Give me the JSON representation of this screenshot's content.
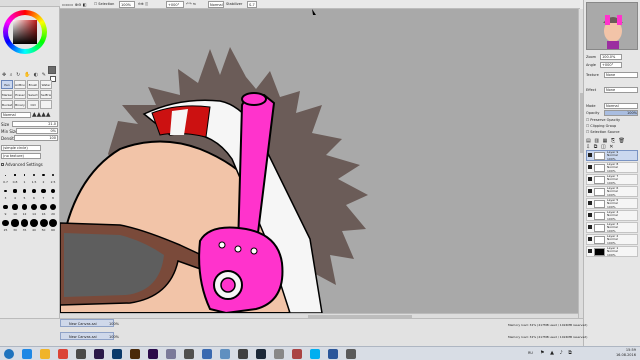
{
  "toolbar": {
    "selection_label": "Selection",
    "zoom_value": "100%",
    "rotation_value": "+000°",
    "blend_value": "Normal",
    "stabilizer_label": "Stabilizer",
    "stabilizer_value": "S-7"
  },
  "tools": {
    "row1": [
      "Pen",
      "AirBrush",
      "Brush",
      "Water"
    ],
    "row2": [
      "Marker",
      "Eraser",
      "Select",
      "SelEraser"
    ],
    "row3": [
      "Bucket",
      "Binary",
      "Old Pen",
      ""
    ],
    "blend_mode": "Normal",
    "size_label": "Size",
    "size_value": "21.0",
    "min_size_label": "Min Size",
    "min_size_value": "0%",
    "density_label": "Density",
    "density_value": "100",
    "shape_value": "(simple circle)",
    "texture_value": "(no texture)",
    "advanced_label": "Advanced Settings",
    "preset_sizes": [
      "0.7",
      "0.8",
      "1",
      "1.5",
      "2",
      "2.5",
      "3",
      "4",
      "5",
      "6",
      "7",
      "8",
      "9",
      "10",
      "12",
      "14",
      "16",
      "20",
      "25",
      "30",
      "35",
      "40",
      "50",
      "60"
    ]
  },
  "navigator": {
    "zoom_label": "Zoom",
    "zoom_value": "100.0%",
    "angle_label": "Angle",
    "angle_value": "+000°"
  },
  "layer_props": {
    "texture_label": "Texture",
    "texture_value": "None",
    "effect_label": "Effect",
    "effect_value": "None",
    "mode_label": "Mode",
    "mode_value": "Normal",
    "opacity_label": "Opacity",
    "opacity_value": "100%",
    "preserve_opacity": "Preserve Opacity",
    "clipping_group": "Clipping Group",
    "selection_source": "Selection Source"
  },
  "layers": [
    {
      "name": "Layer 9",
      "mode": "Normal",
      "opacity": "100%",
      "selected": true
    },
    {
      "name": "Layer 8",
      "mode": "Normal",
      "opacity": "100%",
      "selected": false
    },
    {
      "name": "Layer 7",
      "mode": "Normal",
      "opacity": "100%",
      "selected": false
    },
    {
      "name": "Layer 6",
      "mode": "Normal",
      "opacity": "100%",
      "selected": false
    },
    {
      "name": "Layer 5",
      "mode": "Normal",
      "opacity": "100%",
      "selected": false
    },
    {
      "name": "Layer 4",
      "mode": "Normal",
      "opacity": "100%",
      "selected": false
    },
    {
      "name": "Layer 3",
      "mode": "Normal",
      "opacity": "100%",
      "selected": false
    },
    {
      "name": "Layer 2",
      "mode": "Normal",
      "opacity": "100%",
      "selected": false
    },
    {
      "name": "Layer 1",
      "mode": "Normal",
      "opacity": "100%",
      "selected": false
    }
  ],
  "documents": [
    {
      "name": "New Canvas.sai",
      "zoom": "100%"
    },
    {
      "name": "New Canvas.sai",
      "zoom": "100%"
    }
  ],
  "status": {
    "memory_1": "Memory load: 32% (417MB used / 1024MB reserved)",
    "memory_2": "Memory load: 32% (417MB used / 1024MB reserved)"
  },
  "taskbar": {
    "apps": [
      "start",
      "ie",
      "explorer",
      "chrome",
      "media",
      "premiere",
      "photoshop",
      "illustrator",
      "aftereffects",
      "sai",
      "calculator",
      "paint",
      "notepad",
      "app2",
      "steam",
      "app3",
      "app4",
      "skype",
      "word",
      "app5"
    ],
    "language": "RU",
    "time": "15:59",
    "date": "16.08.2016"
  },
  "colors": {
    "accent": "#cbd8ef",
    "canvas_bg": "#a9a9a9",
    "pink": "#ff33cc",
    "skin": "#f2c4a8",
    "hair": "#6b5c58",
    "glasses": "#7a4a3a",
    "lens": "#5e5e5e",
    "goggles_red": "#cc1111"
  }
}
